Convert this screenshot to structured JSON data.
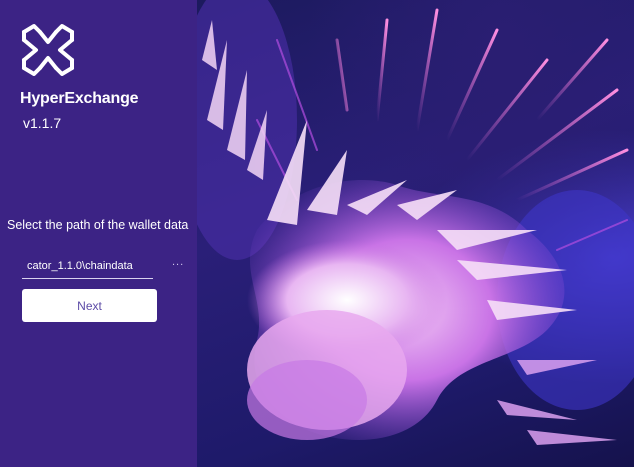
{
  "app": {
    "name": "HyperExchange",
    "version": "v1.1.7"
  },
  "setup": {
    "prompt": "Select the path of the wallet data",
    "path_value": "cator_1.1.0\\chaindata",
    "browse_label": "...",
    "next_label": "Next"
  },
  "colors": {
    "panel": "#3c2385",
    "accent_text": "#5b4aa6"
  },
  "icons": {
    "logo": "hyperexchange-logo-icon",
    "artwork": "abstract-splash-art"
  }
}
